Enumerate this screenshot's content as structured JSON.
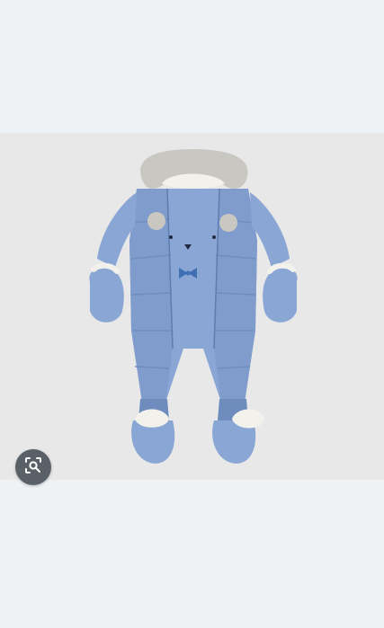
{
  "photo": {
    "subject": "product-photo",
    "colors": {
      "snowsuit": "#8aa6d4",
      "snowsuit_shadow": "#6f8cbf",
      "fur": "#c9c7c2",
      "lining": "#f3f1ec",
      "bow": "#3f6fb5",
      "backdrop": "#e8e8e9"
    }
  },
  "lens_button": {
    "icon": "image-search-icon",
    "color": "#5a6068"
  },
  "page": {
    "background": "#eff2f5"
  }
}
